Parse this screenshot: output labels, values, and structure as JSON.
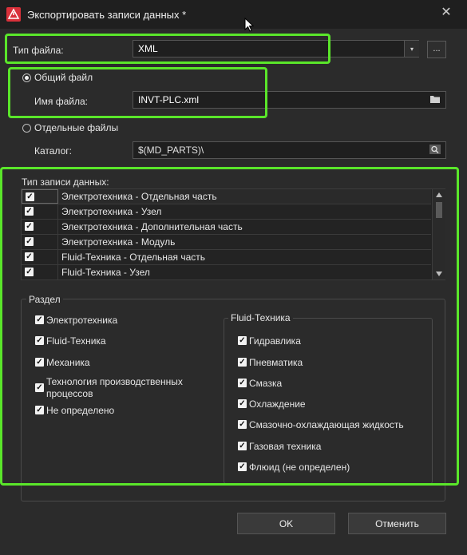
{
  "window": {
    "title": "Экспортировать записи данных *",
    "close_symbol": "✕"
  },
  "file_type": {
    "label": "Тип файла:",
    "value": "XML",
    "dropdown_arrow": "▾",
    "more_button": "..."
  },
  "common_file": {
    "label": "Общий файл",
    "selected": true
  },
  "file_name": {
    "label": "Имя файла:",
    "value": "INVT-PLC.xml",
    "icon": "folder-icon"
  },
  "separate_files": {
    "label": "Отдельные файлы",
    "selected": false
  },
  "catalog": {
    "label": "Каталог:",
    "value": "$(MD_PARTS)\\",
    "icon": "search-icon"
  },
  "record_types": {
    "label": "Тип записи данных:",
    "rows": [
      {
        "checked": true,
        "label": "Электротехника - Отдельная часть"
      },
      {
        "checked": true,
        "label": "Электротехника - Узел"
      },
      {
        "checked": true,
        "label": "Электротехника - Дополнительная часть"
      },
      {
        "checked": true,
        "label": "Электротехника - Модуль"
      },
      {
        "checked": true,
        "label": "Fluid-Техника - Отдельная часть"
      },
      {
        "checked": true,
        "label": "Fluid-Техника - Узел"
      }
    ]
  },
  "section": {
    "label": "Раздел",
    "items": [
      {
        "checked": true,
        "label": "Электротехника"
      },
      {
        "checked": true,
        "label": "Fluid-Техника"
      },
      {
        "checked": true,
        "label": "Механика"
      },
      {
        "checked": true,
        "label": "Технология производственных процессов"
      },
      {
        "checked": true,
        "label": "Не определено"
      }
    ],
    "fluid_group": {
      "label": "Fluid-Техника",
      "items": [
        {
          "checked": true,
          "label": "Гидравлика"
        },
        {
          "checked": true,
          "label": "Пневматика"
        },
        {
          "checked": true,
          "label": "Смазка"
        },
        {
          "checked": true,
          "label": "Охлаждение"
        },
        {
          "checked": true,
          "label": "Смазочно-охлаждающая жидкость"
        },
        {
          "checked": true,
          "label": "Газовая техника"
        },
        {
          "checked": true,
          "label": "Флюид (не определен)"
        }
      ]
    }
  },
  "buttons": {
    "ok": "OK",
    "cancel": "Отменить"
  },
  "colors": {
    "highlight": "#5ae62a",
    "background": "#2b2b2b",
    "accent": "#d9303a"
  },
  "check_mark": "✓"
}
